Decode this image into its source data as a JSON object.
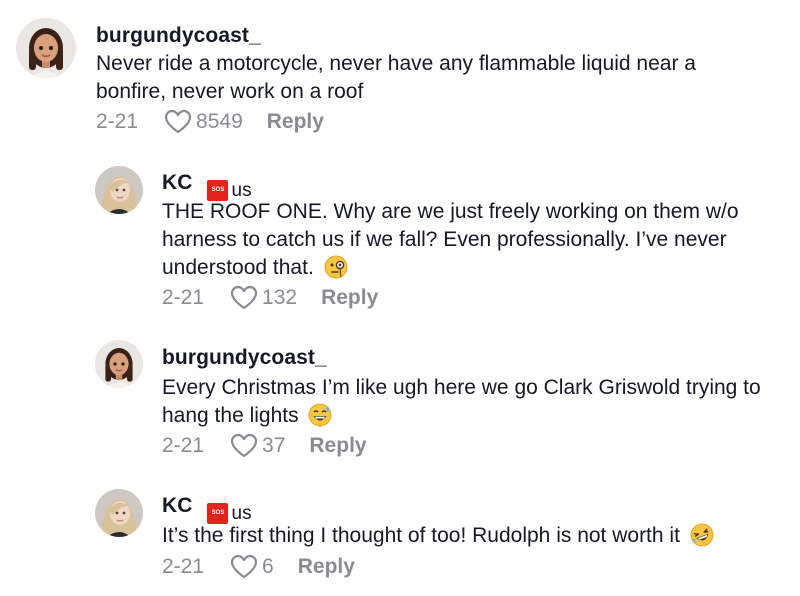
{
  "comments": [
    {
      "username": "burgundycoast_",
      "lines": [
        "Never ride a motorcycle, never have any flammable liquid near a",
        "bonfire, never work on a roof"
      ],
      "date": "2-21",
      "likes": "8549",
      "reply_label": "Reply",
      "avatar_icon": "avatar-girl-cartoon"
    },
    {
      "username": "KC",
      "flag_text": "SOS",
      "country_code": "us",
      "lines": [
        "THE ROOF ONE. Why are we just freely working on them w/o",
        "harness to catch us if we fall? Even professionally. I’ve never",
        "understood that."
      ],
      "emoji": "monocle-face-emoji",
      "date": "2-21",
      "likes": "132",
      "reply_label": "Reply",
      "avatar_icon": "avatar-blonde-woman"
    },
    {
      "username": "burgundycoast_",
      "lines": [
        "Every Christmas I’m like ugh here we go Clark Griswold trying to",
        "hang the lights"
      ],
      "emoji": "grinning-sweat-emoji",
      "date": "2-21",
      "likes": "37",
      "reply_label": "Reply",
      "avatar_icon": "avatar-girl-cartoon"
    },
    {
      "username": "KC",
      "flag_text": "SOS",
      "country_code": "us",
      "lines": [
        "It’s the first thing I thought of too! Rudolph is not worth it"
      ],
      "emoji": "rolling-laughing-emoji",
      "date": "2-21",
      "likes": "6",
      "reply_label": "Reply",
      "avatar_icon": "avatar-blonde-woman"
    }
  ],
  "colors": {
    "text": "#161823",
    "muted": "#8a8b91",
    "flag": "#e2231a"
  }
}
